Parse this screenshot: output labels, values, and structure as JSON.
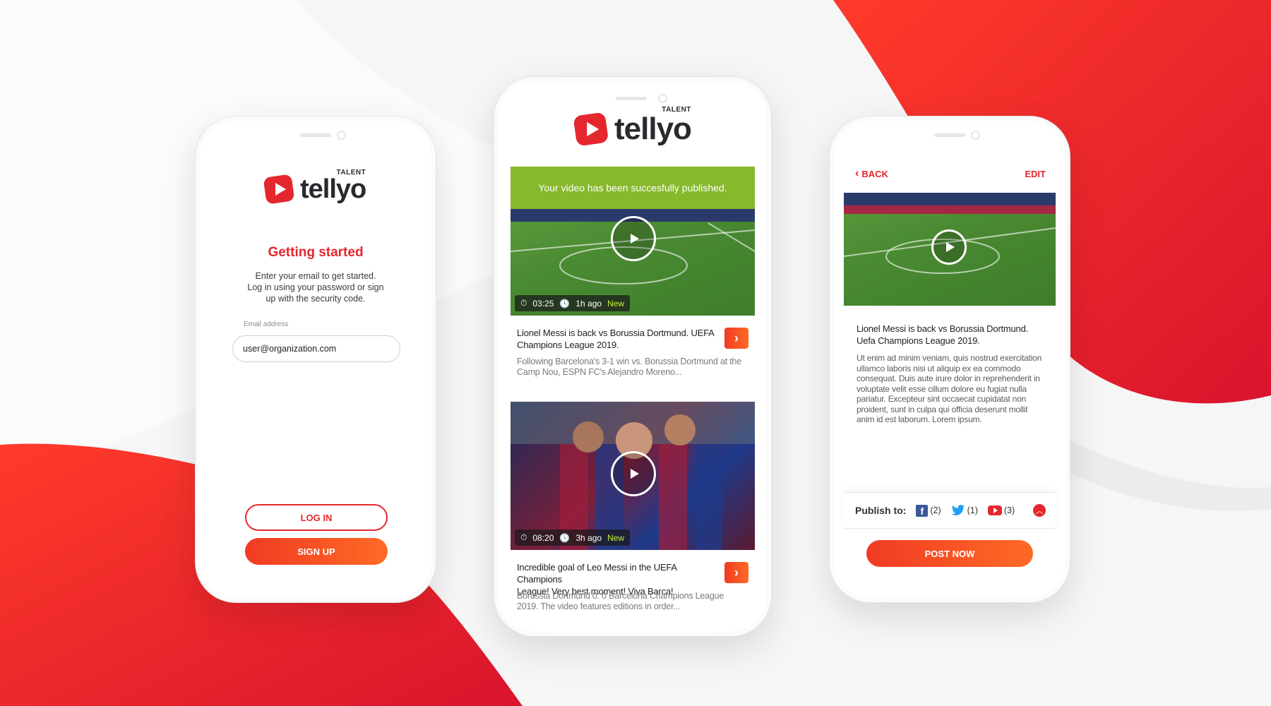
{
  "colors": {
    "accent": "#e4272c",
    "success": "#86b92c",
    "new_badge": "#c6f13a"
  },
  "brand": {
    "name": "tellyo",
    "sub": "TALENT"
  },
  "login": {
    "title": "Getting started",
    "intro_line1": "Enter your email to get started.",
    "intro_line2": "Log in using your password or sign",
    "intro_line3": "up with the security code.",
    "email_label": "Email address",
    "email_value": "user@organization.com",
    "login_label": "LOG IN",
    "signup_label": "SIGN UP"
  },
  "feed": {
    "banner": "Your video has been succesfully published.",
    "videos": [
      {
        "duration": "03:25",
        "age": "1h ago",
        "badge": "New",
        "title_line1": "Lionel Messi is back vs Borussia Dortmund. UEFA",
        "title_line2": "Champions League 2019.",
        "desc_line1": "Following Barcelona's 3-1 win vs. Borussia Dortmund at the",
        "desc_line2": "Camp Nou, ESPN FC's Alejandro Moreno..."
      },
      {
        "duration": "08:20",
        "age": "3h ago",
        "badge": "New",
        "title_line1": "Incredible goal of Leo Messi in the UEFA Champions",
        "title_line2": "League! Very best moment! Viva Barca!",
        "desc_line1": "Borussia Dortmund 0: 0 Barcelona Champions League",
        "desc_line2": "2019. The video features editions in order..."
      }
    ]
  },
  "detail": {
    "back_label": "BACK",
    "edit_label": "EDIT",
    "title_line1": "Lionel Messi is back vs Borussia Dortmund.",
    "title_line2": "Uefa Champions League 2019.",
    "body": [
      "Ut enim ad minim veniam, quis nostrud exercitation",
      "ullamco laboris nisi ut aliquip ex ea commodo",
      "consequat. Duis aute irure dolor in reprehenderit in",
      "voluptate velit esse cillum dolore eu fugiat nulla",
      "pariatur. Excepteur sint occaecat cupidatat non",
      "proident, sunt in culpa qui officia deserunt mollit",
      "anim id est laborum. Lorem ipsum."
    ],
    "publish_label": "Publish to:",
    "facebook_count": "(2)",
    "twitter_count": "(1)",
    "youtube_count": "(3)",
    "post_label": "POST NOW"
  }
}
